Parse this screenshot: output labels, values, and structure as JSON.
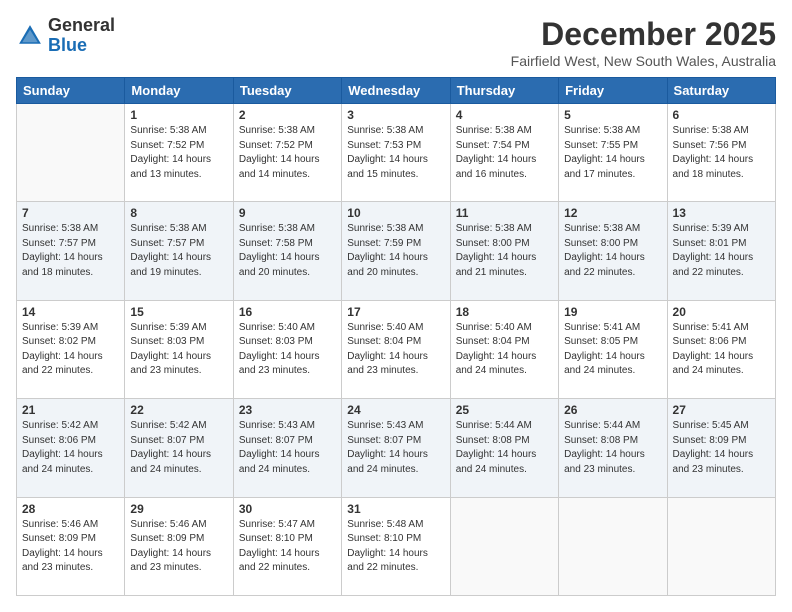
{
  "logo": {
    "general": "General",
    "blue": "Blue"
  },
  "header": {
    "month": "December 2025",
    "location": "Fairfield West, New South Wales, Australia"
  },
  "weekdays": [
    "Sunday",
    "Monday",
    "Tuesday",
    "Wednesday",
    "Thursday",
    "Friday",
    "Saturday"
  ],
  "weeks": [
    [
      {
        "day": "",
        "sunrise": "",
        "sunset": "",
        "daylight": ""
      },
      {
        "day": "1",
        "sunrise": "Sunrise: 5:38 AM",
        "sunset": "Sunset: 7:52 PM",
        "daylight": "Daylight: 14 hours and 13 minutes."
      },
      {
        "day": "2",
        "sunrise": "Sunrise: 5:38 AM",
        "sunset": "Sunset: 7:52 PM",
        "daylight": "Daylight: 14 hours and 14 minutes."
      },
      {
        "day": "3",
        "sunrise": "Sunrise: 5:38 AM",
        "sunset": "Sunset: 7:53 PM",
        "daylight": "Daylight: 14 hours and 15 minutes."
      },
      {
        "day": "4",
        "sunrise": "Sunrise: 5:38 AM",
        "sunset": "Sunset: 7:54 PM",
        "daylight": "Daylight: 14 hours and 16 minutes."
      },
      {
        "day": "5",
        "sunrise": "Sunrise: 5:38 AM",
        "sunset": "Sunset: 7:55 PM",
        "daylight": "Daylight: 14 hours and 17 minutes."
      },
      {
        "day": "6",
        "sunrise": "Sunrise: 5:38 AM",
        "sunset": "Sunset: 7:56 PM",
        "daylight": "Daylight: 14 hours and 18 minutes."
      }
    ],
    [
      {
        "day": "7",
        "sunrise": "Sunrise: 5:38 AM",
        "sunset": "Sunset: 7:57 PM",
        "daylight": "Daylight: 14 hours and 18 minutes."
      },
      {
        "day": "8",
        "sunrise": "Sunrise: 5:38 AM",
        "sunset": "Sunset: 7:57 PM",
        "daylight": "Daylight: 14 hours and 19 minutes."
      },
      {
        "day": "9",
        "sunrise": "Sunrise: 5:38 AM",
        "sunset": "Sunset: 7:58 PM",
        "daylight": "Daylight: 14 hours and 20 minutes."
      },
      {
        "day": "10",
        "sunrise": "Sunrise: 5:38 AM",
        "sunset": "Sunset: 7:59 PM",
        "daylight": "Daylight: 14 hours and 20 minutes."
      },
      {
        "day": "11",
        "sunrise": "Sunrise: 5:38 AM",
        "sunset": "Sunset: 8:00 PM",
        "daylight": "Daylight: 14 hours and 21 minutes."
      },
      {
        "day": "12",
        "sunrise": "Sunrise: 5:38 AM",
        "sunset": "Sunset: 8:00 PM",
        "daylight": "Daylight: 14 hours and 22 minutes."
      },
      {
        "day": "13",
        "sunrise": "Sunrise: 5:39 AM",
        "sunset": "Sunset: 8:01 PM",
        "daylight": "Daylight: 14 hours and 22 minutes."
      }
    ],
    [
      {
        "day": "14",
        "sunrise": "Sunrise: 5:39 AM",
        "sunset": "Sunset: 8:02 PM",
        "daylight": "Daylight: 14 hours and 22 minutes."
      },
      {
        "day": "15",
        "sunrise": "Sunrise: 5:39 AM",
        "sunset": "Sunset: 8:03 PM",
        "daylight": "Daylight: 14 hours and 23 minutes."
      },
      {
        "day": "16",
        "sunrise": "Sunrise: 5:40 AM",
        "sunset": "Sunset: 8:03 PM",
        "daylight": "Daylight: 14 hours and 23 minutes."
      },
      {
        "day": "17",
        "sunrise": "Sunrise: 5:40 AM",
        "sunset": "Sunset: 8:04 PM",
        "daylight": "Daylight: 14 hours and 23 minutes."
      },
      {
        "day": "18",
        "sunrise": "Sunrise: 5:40 AM",
        "sunset": "Sunset: 8:04 PM",
        "daylight": "Daylight: 14 hours and 24 minutes."
      },
      {
        "day": "19",
        "sunrise": "Sunrise: 5:41 AM",
        "sunset": "Sunset: 8:05 PM",
        "daylight": "Daylight: 14 hours and 24 minutes."
      },
      {
        "day": "20",
        "sunrise": "Sunrise: 5:41 AM",
        "sunset": "Sunset: 8:06 PM",
        "daylight": "Daylight: 14 hours and 24 minutes."
      }
    ],
    [
      {
        "day": "21",
        "sunrise": "Sunrise: 5:42 AM",
        "sunset": "Sunset: 8:06 PM",
        "daylight": "Daylight: 14 hours and 24 minutes."
      },
      {
        "day": "22",
        "sunrise": "Sunrise: 5:42 AM",
        "sunset": "Sunset: 8:07 PM",
        "daylight": "Daylight: 14 hours and 24 minutes."
      },
      {
        "day": "23",
        "sunrise": "Sunrise: 5:43 AM",
        "sunset": "Sunset: 8:07 PM",
        "daylight": "Daylight: 14 hours and 24 minutes."
      },
      {
        "day": "24",
        "sunrise": "Sunrise: 5:43 AM",
        "sunset": "Sunset: 8:07 PM",
        "daylight": "Daylight: 14 hours and 24 minutes."
      },
      {
        "day": "25",
        "sunrise": "Sunrise: 5:44 AM",
        "sunset": "Sunset: 8:08 PM",
        "daylight": "Daylight: 14 hours and 24 minutes."
      },
      {
        "day": "26",
        "sunrise": "Sunrise: 5:44 AM",
        "sunset": "Sunset: 8:08 PM",
        "daylight": "Daylight: 14 hours and 23 minutes."
      },
      {
        "day": "27",
        "sunrise": "Sunrise: 5:45 AM",
        "sunset": "Sunset: 8:09 PM",
        "daylight": "Daylight: 14 hours and 23 minutes."
      }
    ],
    [
      {
        "day": "28",
        "sunrise": "Sunrise: 5:46 AM",
        "sunset": "Sunset: 8:09 PM",
        "daylight": "Daylight: 14 hours and 23 minutes."
      },
      {
        "day": "29",
        "sunrise": "Sunrise: 5:46 AM",
        "sunset": "Sunset: 8:09 PM",
        "daylight": "Daylight: 14 hours and 23 minutes."
      },
      {
        "day": "30",
        "sunrise": "Sunrise: 5:47 AM",
        "sunset": "Sunset: 8:10 PM",
        "daylight": "Daylight: 14 hours and 22 minutes."
      },
      {
        "day": "31",
        "sunrise": "Sunrise: 5:48 AM",
        "sunset": "Sunset: 8:10 PM",
        "daylight": "Daylight: 14 hours and 22 minutes."
      },
      {
        "day": "",
        "sunrise": "",
        "sunset": "",
        "daylight": ""
      },
      {
        "day": "",
        "sunrise": "",
        "sunset": "",
        "daylight": ""
      },
      {
        "day": "",
        "sunrise": "",
        "sunset": "",
        "daylight": ""
      }
    ]
  ]
}
